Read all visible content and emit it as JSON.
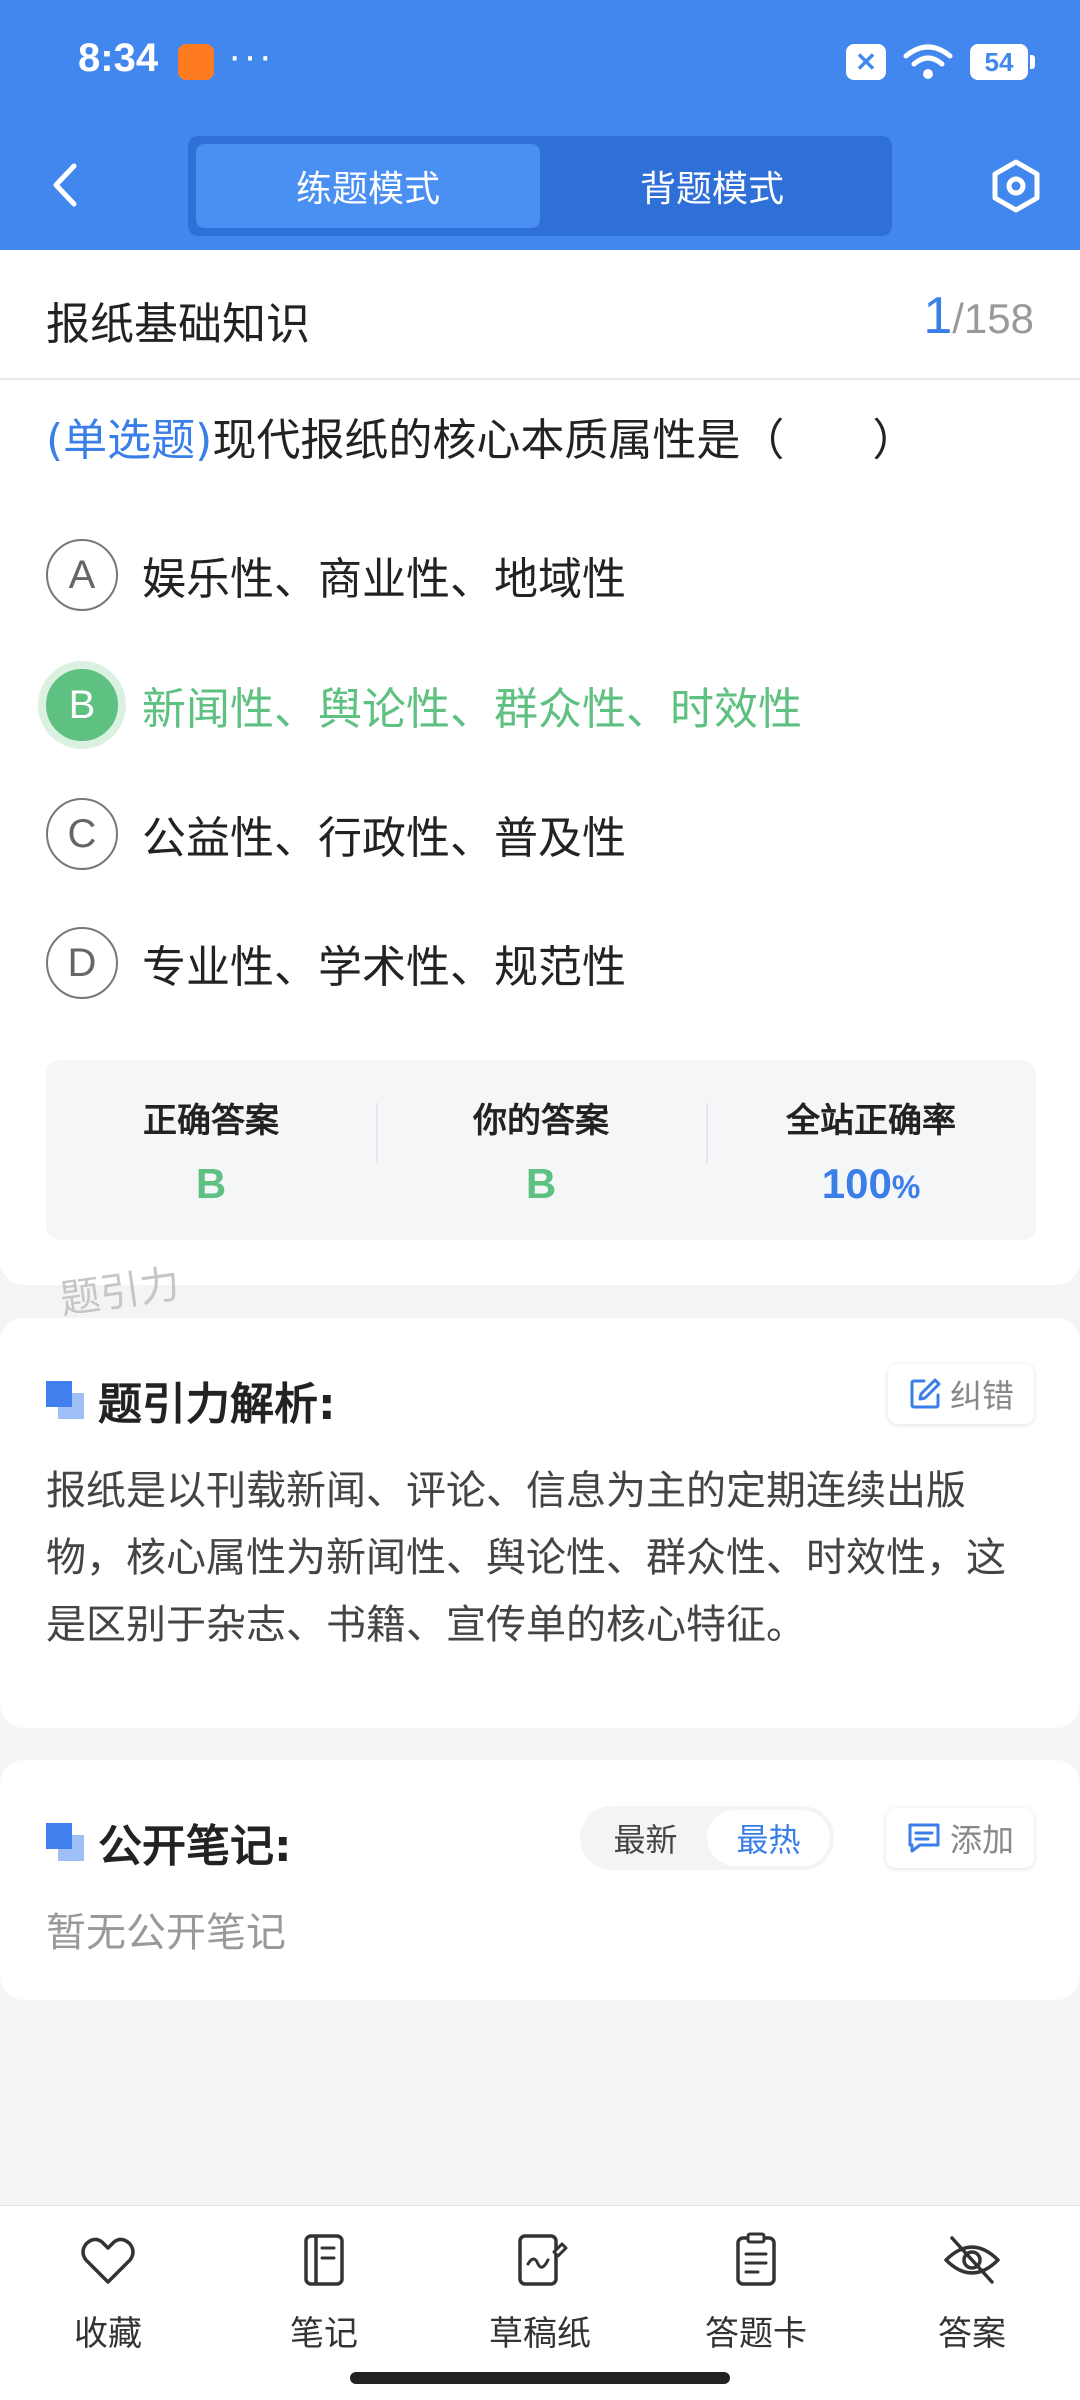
{
  "status_bar": {
    "time": "8:34",
    "more": "···",
    "battery": "54"
  },
  "header": {
    "mode_tabs": [
      {
        "label": "练题模式",
        "active": true
      },
      {
        "label": "背题模式",
        "active": false
      }
    ]
  },
  "question_card": {
    "topic": "报纸基础知识",
    "current": "1",
    "total": "/158",
    "question_type": "(单选题)",
    "question_text": "现代报纸的核心本质属性是（　　）",
    "options": [
      {
        "letter": "A",
        "text": "娱乐性、商业性、地域性",
        "state": "normal"
      },
      {
        "letter": "B",
        "text": "新闻性、舆论性、群众性、时效性",
        "state": "correct"
      },
      {
        "letter": "C",
        "text": "公益性、行政性、普及性",
        "state": "normal"
      },
      {
        "letter": "D",
        "text": "专业性、学术性、规范性",
        "state": "normal"
      }
    ],
    "stats": [
      {
        "label": "正确答案",
        "value": "B",
        "unit": ""
      },
      {
        "label": "你的答案",
        "value": "B",
        "unit": ""
      },
      {
        "label": "全站正确率",
        "value": "100",
        "unit": "%"
      }
    ]
  },
  "watermark": "题引力",
  "analysis": {
    "title": "题引力解析:",
    "report_label": "纠错",
    "text": "报纸是以刊载新闻、评论、信息为主的定期连续出版物，核心属性为新闻性、舆论性、群众性、时效性，这是区别于杂志、书籍、宣传单的核心特征。"
  },
  "notes": {
    "title": "公开笔记:",
    "sort_tabs": [
      {
        "label": "最新",
        "active": false
      },
      {
        "label": "最热",
        "active": true
      }
    ],
    "add_label": "添加",
    "empty_text": "暂无公开笔记"
  },
  "bottom_nav": [
    {
      "label": "收藏",
      "icon": "heart-icon"
    },
    {
      "label": "笔记",
      "icon": "notebook-icon"
    },
    {
      "label": "草稿纸",
      "icon": "draft-paper-icon"
    },
    {
      "label": "答题卡",
      "icon": "answer-sheet-icon"
    },
    {
      "label": "答案",
      "icon": "eye-off-icon"
    }
  ],
  "colors": {
    "brand_blue": "#4287ee",
    "correct_green": "#5ec081"
  }
}
